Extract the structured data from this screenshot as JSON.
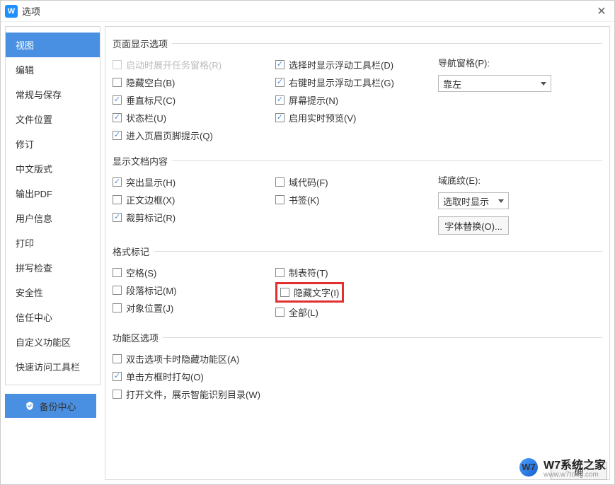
{
  "title": "选项",
  "sidebar": {
    "items": [
      "视图",
      "编辑",
      "常规与保存",
      "文件位置",
      "修订",
      "中文版式",
      "输出PDF",
      "用户信息",
      "打印",
      "拼写检查",
      "安全性",
      "信任中心",
      "自定义功能区",
      "快速访问工具栏"
    ],
    "active_index": 0,
    "backup": "备份中心"
  },
  "sections": {
    "page_display": {
      "title": "页面显示选项",
      "col1": [
        {
          "label": "启动时展开任务窗格(R)",
          "checked": false,
          "disabled": true
        },
        {
          "label": "隐藏空白(B)",
          "checked": false
        },
        {
          "label": "垂直标尺(C)",
          "checked": true
        },
        {
          "label": "状态栏(U)",
          "checked": true
        },
        {
          "label": "进入页眉页脚提示(Q)",
          "checked": true
        }
      ],
      "col2": [
        {
          "label": "选择时显示浮动工具栏(D)",
          "checked": true
        },
        {
          "label": "右键时显示浮动工具栏(G)",
          "checked": true
        },
        {
          "label": "屏幕提示(N)",
          "checked": true
        },
        {
          "label": "启用实时预览(V)",
          "checked": true
        }
      ],
      "nav_label": "导航窗格(P):",
      "nav_value": "靠左"
    },
    "doc_content": {
      "title": "显示文档内容",
      "col1": [
        {
          "label": "突出显示(H)",
          "checked": true
        },
        {
          "label": "正文边框(X)",
          "checked": false
        },
        {
          "label": "裁剪标记(R)",
          "checked": true
        }
      ],
      "col2": [
        {
          "label": "域代码(F)",
          "checked": false
        },
        {
          "label": "书签(K)",
          "checked": false
        }
      ],
      "shade_label": "域底纹(E):",
      "shade_value": "选取时显示",
      "font_sub_btn": "字体替换(O)..."
    },
    "format_marks": {
      "title": "格式标记",
      "col1": [
        {
          "label": "空格(S)",
          "checked": false
        },
        {
          "label": "段落标记(M)",
          "checked": false
        },
        {
          "label": "对象位置(J)",
          "checked": false
        }
      ],
      "col2": [
        {
          "label": "制表符(T)",
          "checked": false
        },
        {
          "label": "隐藏文字(I)",
          "checked": false,
          "highlighted": true
        },
        {
          "label": "全部(L)",
          "checked": false
        }
      ]
    },
    "ribbon": {
      "title": "功能区选项",
      "items": [
        {
          "label": "双击选项卡时隐藏功能区(A)",
          "checked": false
        },
        {
          "label": "单击方框时打勾(O)",
          "checked": true
        },
        {
          "label": "打开文件，展示智能识别目录(W)",
          "checked": false
        }
      ]
    }
  },
  "footer": {
    "ok": "确"
  },
  "watermark": {
    "text": "W7系统之家",
    "sub": "www.w7tong.com",
    "logo": "W7"
  }
}
